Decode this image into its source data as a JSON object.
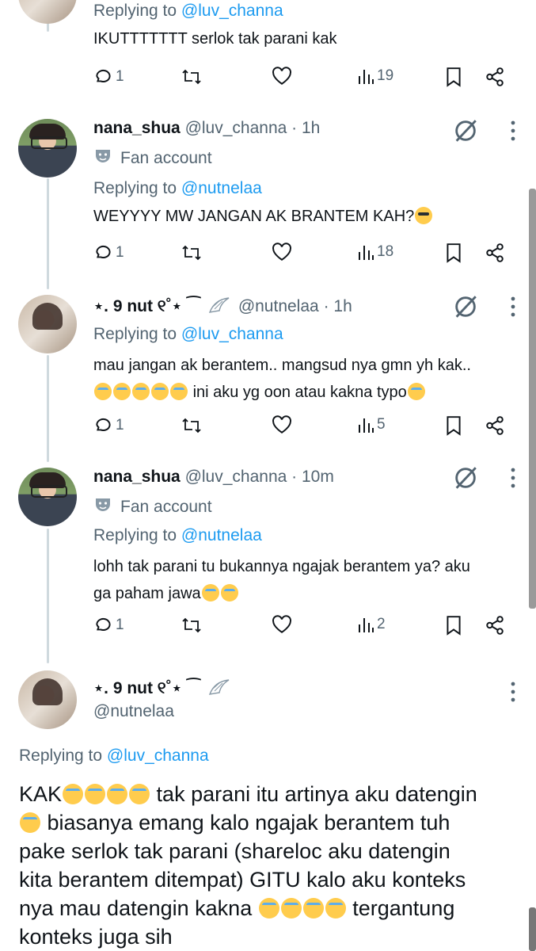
{
  "tweets": [
    {
      "reply_prefix": "Replying to",
      "reply_to": "@luv_channa",
      "text": "IKUTTTTTTT serlok tak parani kak",
      "replies": "1",
      "views": "19"
    },
    {
      "name": "nana_shua",
      "handle": "@luv_channa",
      "time": "· 1h",
      "label": "Fan account",
      "reply_prefix": "Replying to",
      "reply_to": "@nutnelaa",
      "text": "WEYYYY MW JANGAN AK BRANTEM KAH?",
      "replies": "1",
      "views": "18"
    },
    {
      "name": "⋆. 9 nut ୧˚⋆ ⁀",
      "handle": "@nutnelaa",
      "time": "· 1h",
      "reply_prefix": "Replying to",
      "reply_to": "@luv_channa",
      "text_line1": "mau jangan ak berantem.. mangsud nya gmn yh kak..",
      "text_line2": "ini aku yg oon atau kakna typo",
      "replies": "1",
      "views": "5"
    },
    {
      "name": "nana_shua",
      "handle": "@luv_channa",
      "time": "· 10m",
      "label": "Fan account",
      "reply_prefix": "Replying to",
      "reply_to": "@nutnelaa",
      "text_line1": "lohh tak parani tu bukannya ngajak berantem ya? aku",
      "text_line2": "ga paham jawa",
      "replies": "1",
      "views": "2"
    }
  ],
  "main_tweet": {
    "name": "⋆. 9 nut ୧˚⋆ ⁀",
    "handle": "@nutnelaa",
    "reply_prefix": "Replying to",
    "reply_to": "@luv_channa",
    "line1_a": "KAK",
    "line1_b": "tak parani itu artinya aku datengin",
    "line2": "biasanya emang kalo ngajak berantem tuh",
    "line3": "pake serlok tak parani (shareloc aku datengin",
    "line4": "kita berantem ditempat) GITU kalo aku konteks",
    "line5_a": "nya mau datengin kakna",
    "line5_b": "tergantung",
    "line6": "konteks juga sih"
  },
  "colors": {
    "accent": "#1d9bf0",
    "muted": "#536471",
    "text": "#0f1419"
  }
}
